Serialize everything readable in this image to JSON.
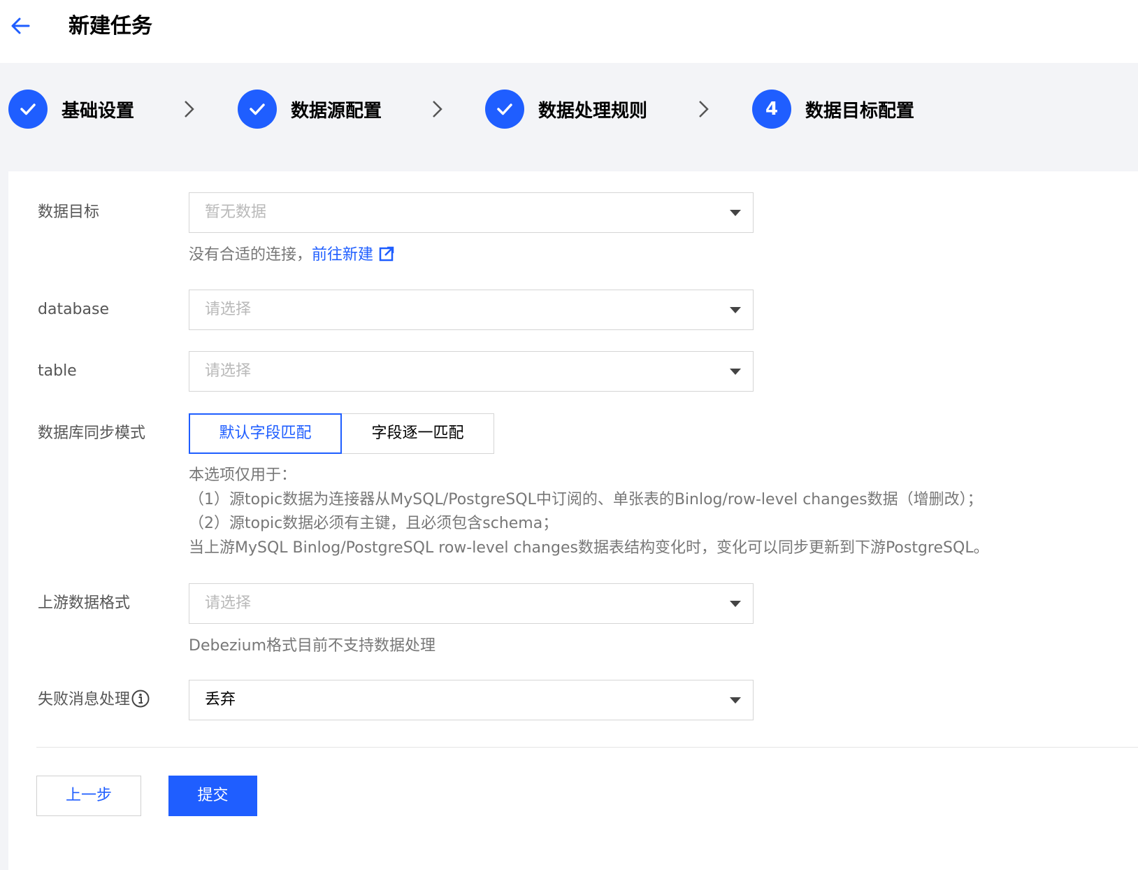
{
  "header": {
    "title": "新建任务",
    "back_icon": "arrow-left-icon"
  },
  "steps": [
    {
      "label": "基础设置",
      "state": "done"
    },
    {
      "label": "数据源配置",
      "state": "done"
    },
    {
      "label": "数据处理规则",
      "state": "done"
    },
    {
      "label": "数据目标配置",
      "state": "current",
      "number": "4"
    }
  ],
  "form": {
    "target": {
      "label": "数据目标",
      "placeholder": "暂无数据",
      "hint_text": "没有合适的连接，",
      "hint_link": "前往新建"
    },
    "database": {
      "label": "database",
      "placeholder": "请选择"
    },
    "table": {
      "label": "table",
      "placeholder": "请选择"
    },
    "sync_mode": {
      "label": "数据库同步模式",
      "options": [
        "默认字段匹配",
        "字段逐一匹配"
      ],
      "selected": "默认字段匹配",
      "description": [
        "本选项仅用于：",
        "（1）源topic数据为连接器从MySQL/PostgreSQL中订阅的、单张表的Binlog/row-level changes数据（增删改）；",
        "（2）源topic数据必须有主键，且必须包含schema；",
        "当上游MySQL Binlog/PostgreSQL row-level changes数据表结构变化时，变化可以同步更新到下游PostgreSQL。"
      ]
    },
    "upstream_format": {
      "label": "上游数据格式",
      "placeholder": "请选择",
      "hint": "Debezium格式目前不支持数据处理"
    },
    "failure_handling": {
      "label": "失败消息处理",
      "value": "丢弃"
    }
  },
  "footer": {
    "prev_label": "上一步",
    "submit_label": "提交"
  },
  "colors": {
    "primary": "#1f5eff",
    "page_bg": "#f3f4f7"
  }
}
